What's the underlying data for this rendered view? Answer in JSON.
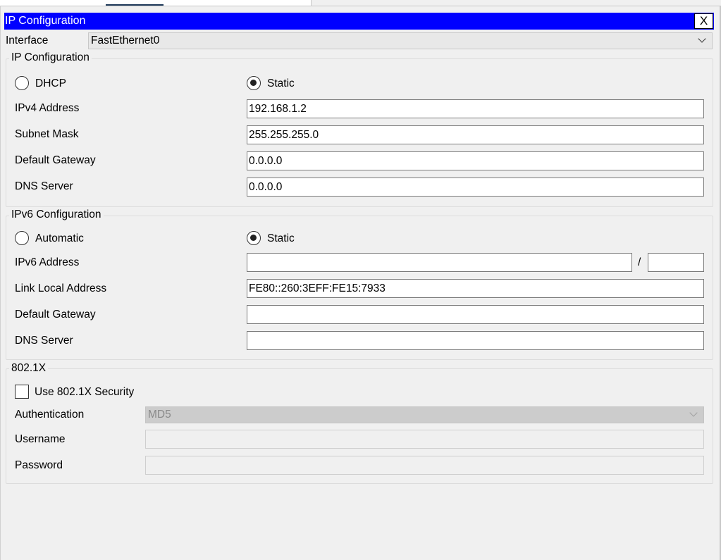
{
  "window": {
    "title": "IP Configuration",
    "close_label": "X"
  },
  "interface": {
    "label": "Interface",
    "selected": "FastEthernet0"
  },
  "ipv4": {
    "group_title": "IP Configuration",
    "dhcp_label": "DHCP",
    "static_label": "Static",
    "mode": "static",
    "address_label": "IPv4 Address",
    "address": "192.168.1.2",
    "subnet_label": "Subnet Mask",
    "subnet": "255.255.255.0",
    "gateway_label": "Default Gateway",
    "gateway": "0.0.0.0",
    "dns_label": "DNS Server",
    "dns": "0.0.0.0"
  },
  "ipv6": {
    "group_title": "IPv6 Configuration",
    "auto_label": "Automatic",
    "static_label": "Static",
    "mode": "static",
    "address_label": "IPv6 Address",
    "address": "",
    "prefix_separator": "/",
    "prefix": "",
    "link_local_label": "Link Local Address",
    "link_local": "FE80::260:3EFF:FE15:7933",
    "gateway_label": "Default Gateway",
    "gateway": "",
    "dns_label": "DNS Server",
    "dns": ""
  },
  "dot1x": {
    "group_title": "802.1X",
    "use_security_label": "Use 802.1X Security",
    "use_security": false,
    "auth_label": "Authentication",
    "auth_method": "MD5",
    "username_label": "Username",
    "username": "",
    "password_label": "Password",
    "password": ""
  }
}
